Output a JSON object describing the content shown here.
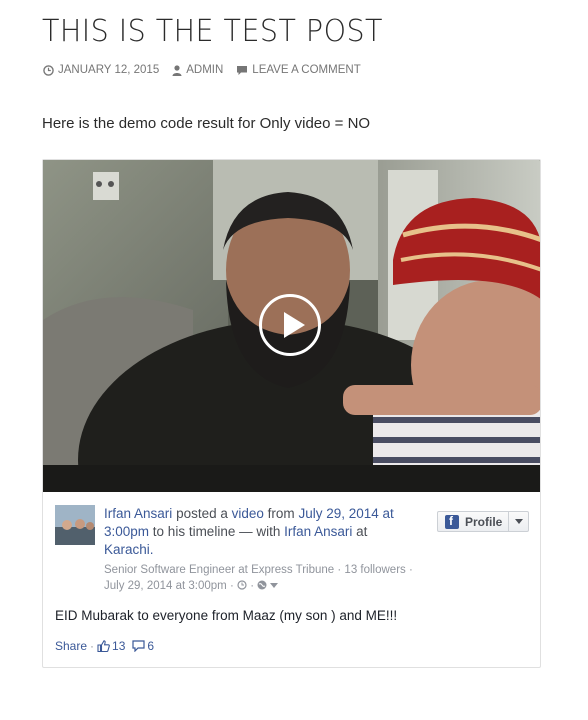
{
  "post": {
    "title": "THIS IS THE TEST POST",
    "meta": {
      "date": "JANUARY 12, 2015",
      "author": "ADMIN",
      "comment_link": "LEAVE A COMMENT"
    },
    "intro": "Here is the demo code  result for Only video = NO"
  },
  "embed": {
    "author_name": "Irfan Ansari",
    "posted_text": "posted a",
    "video_link": "video",
    "from_text": "from",
    "date_link": "July 29, 2014 at 3:00pm",
    "timeline_text": "to his timeline — with",
    "tagged_name": "Irfan Ansari",
    "at_text": "at",
    "place": "Karachi.",
    "job_title": "Senior Software Engineer",
    "job_at": "at",
    "company": "Express Tribune",
    "followers": "13 followers",
    "timestamp": "July 29, 2014 at 3:00pm",
    "profile_button": "Profile",
    "message": "EID Mubarak to everyone from Maaz (my son ) and ME!!!",
    "share_label": "Share",
    "likes": "13",
    "comments": "6",
    "brand_color": "#3b5998"
  }
}
